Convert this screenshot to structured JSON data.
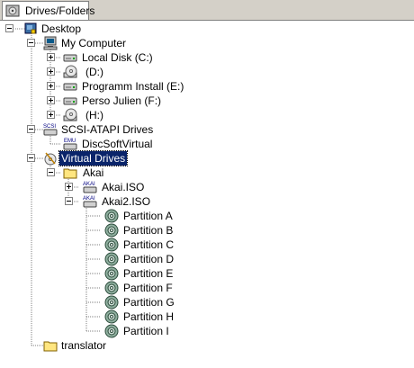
{
  "tab": {
    "label": "Drives/Folders"
  },
  "tree": {
    "desktop": "Desktop",
    "my_computer": "My Computer",
    "local_disk_c": "Local Disk (C:)",
    "drive_d": "(D:)",
    "programm_install_e": "Programm Install (E:)",
    "perso_julien_f": "Perso Julien (F:)",
    "drive_h": "(H:)",
    "scsi_atapi_drives": "SCSI-ATAPI Drives",
    "disc_soft_virtual": "DiscSoftVirtual",
    "virtual_drives": "Virtual Drives",
    "akai": "Akai",
    "akai_iso": "Akai.ISO",
    "akai2_iso": "Akai2.ISO",
    "partitions": [
      "Partition A",
      "Partition B",
      "Partition C",
      "Partition D",
      "Partition E",
      "Partition F",
      "Partition G",
      "Partition H",
      "Partition I"
    ],
    "translator": "translator"
  },
  "icon_text": {
    "scsi": "SCSI",
    "emu": "EMU",
    "akai": "AKAI"
  },
  "colors": {
    "selection": "#0a246a",
    "folder": "#ffe680",
    "guide": "#808080"
  }
}
